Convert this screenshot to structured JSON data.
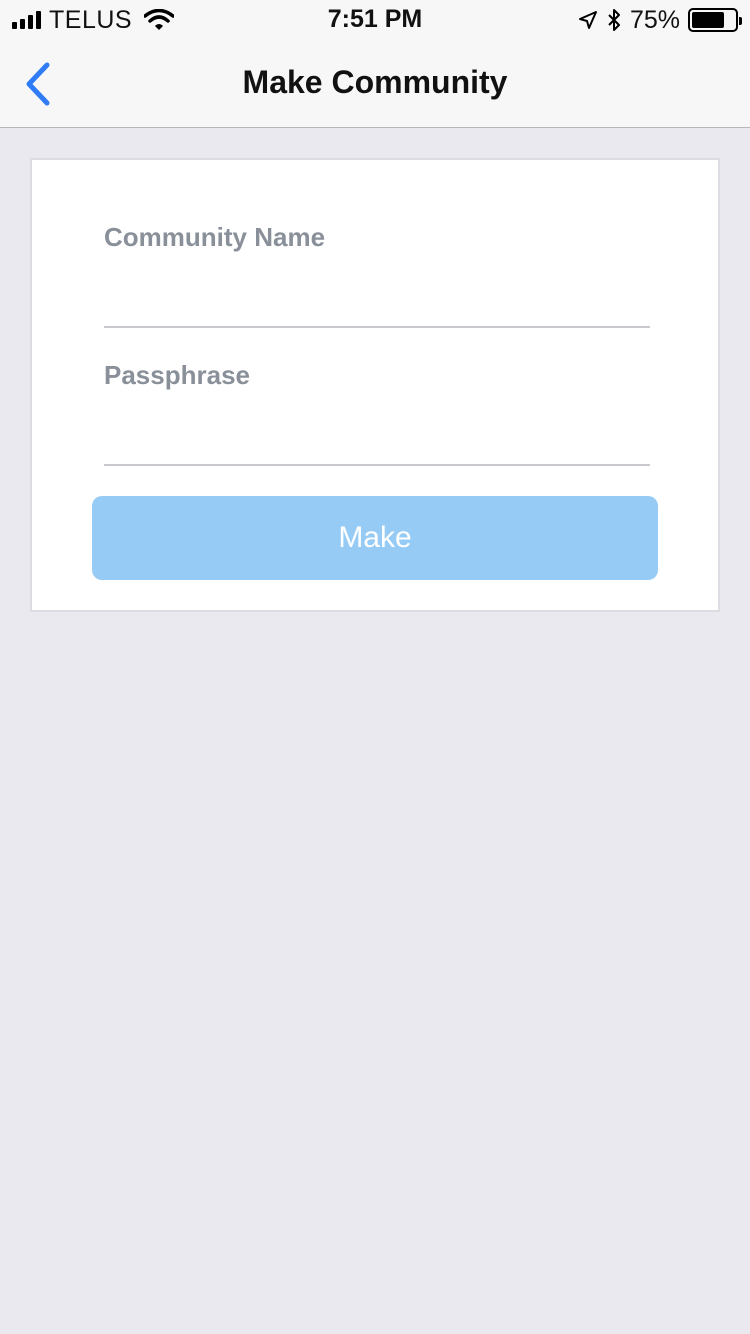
{
  "status_bar": {
    "carrier": "TELUS",
    "time": "7:51 PM",
    "battery_percent": "75%",
    "battery_level": 0.75,
    "icons": [
      "signal-icon",
      "wifi-icon",
      "location-icon",
      "bluetooth-icon",
      "battery-icon"
    ]
  },
  "nav": {
    "title": "Make Community",
    "back_icon": "chevron-left-icon",
    "accent_color": "#2f7cf6"
  },
  "form": {
    "community_name_label": "Community Name",
    "community_name_value": "",
    "passphrase_label": "Passphrase",
    "passphrase_value": "",
    "make_button_label": "Make",
    "make_button_color": "#96cbf5"
  }
}
